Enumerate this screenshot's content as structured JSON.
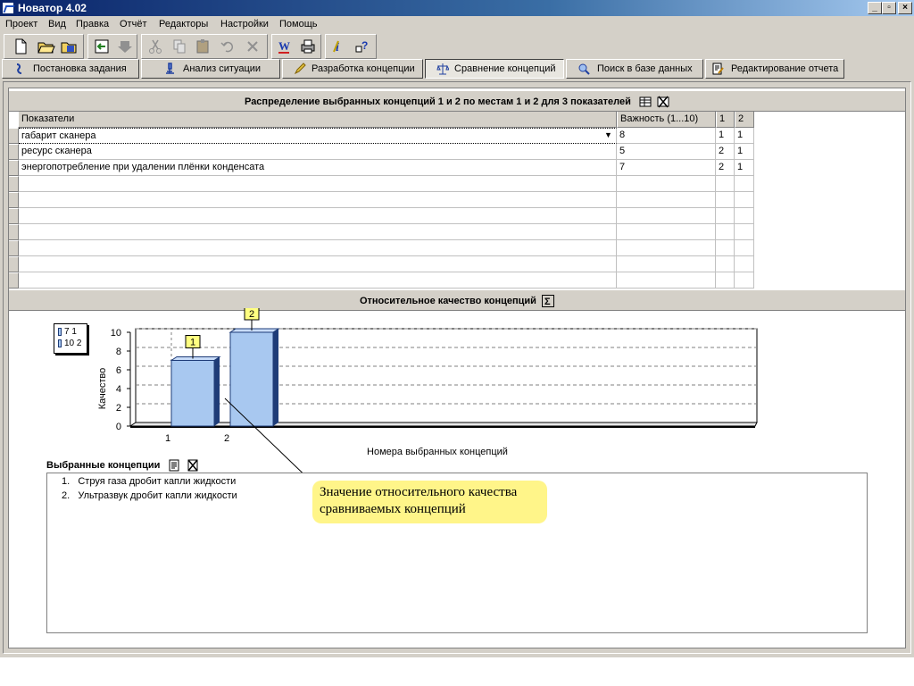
{
  "window": {
    "title": "Новатор 4.02",
    "min": "_",
    "restore": "▫",
    "close": "×"
  },
  "menu": [
    "Проект",
    "Вид",
    "Правка",
    "Отчёт",
    "Редакторы",
    "Настройки",
    "Помощь"
  ],
  "tabs": [
    {
      "label": "Постановка задания",
      "icon": "task-setup-icon"
    },
    {
      "label": "Анализ ситуации",
      "icon": "microscope-icon"
    },
    {
      "label": "Разработка концепции",
      "icon": "pencil-icon"
    },
    {
      "label": "Сравнение концепций",
      "icon": "scales-icon",
      "active": true
    },
    {
      "label": "Поиск в базе данных",
      "icon": "database-search-icon"
    },
    {
      "label": "Редактирование отчета",
      "icon": "report-edit-icon"
    }
  ],
  "distribution": {
    "title": "Распределение выбранных концепций 1 и 2 по местам 1 и 2 для 3 показателей",
    "columns": [
      "Показатели",
      "Важность (1...10)",
      "1",
      "2"
    ],
    "rows": [
      {
        "indicator": "габарит сканера",
        "importance": "8",
        "c1": "1",
        "c2": "1"
      },
      {
        "indicator": "ресурс сканера",
        "importance": "5",
        "c1": "2",
        "c2": "1"
      },
      {
        "indicator": "энергопотребление при удалении плёнки конденсата",
        "importance": "7",
        "c1": "2",
        "c2": "1"
      }
    ]
  },
  "quality": {
    "title": "Относительное качество концепций"
  },
  "chart_data": {
    "type": "bar",
    "categories": [
      "1",
      "2"
    ],
    "values": [
      7,
      10
    ],
    "bar_labels": [
      "1",
      "2"
    ],
    "legend": [
      "7 1",
      "10 2"
    ],
    "xlabel": "Номера выбранных концепций",
    "ylabel": "Качество",
    "ylim": [
      0,
      10
    ],
    "yticks": [
      0,
      2,
      4,
      6,
      8,
      10
    ],
    "grid": true,
    "bar_color": "#a8c8f0",
    "legend_position": "top-left"
  },
  "concepts": {
    "label": "Выбранные концепции",
    "items": [
      "Струя газа дробит капли жидкости",
      "Ультразвук дробит капли жидкости"
    ]
  },
  "callout": {
    "text": "Значение относительного качества сравниваемых концепций"
  }
}
